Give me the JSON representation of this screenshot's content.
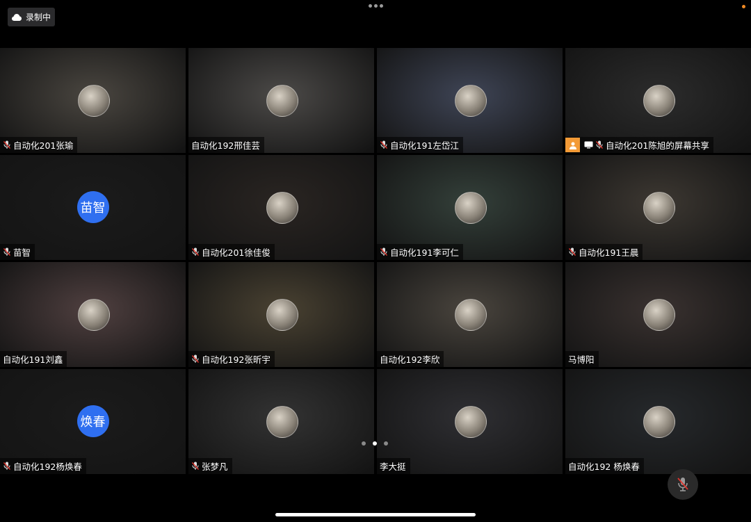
{
  "recording": {
    "label": "录制中",
    "icon": "cloud-icon"
  },
  "colors": {
    "avatar_text_bg": "#2f6ff0",
    "share_chip": "#f39a36",
    "muted_mic": "#e0372f",
    "page_bg": "#000000"
  },
  "participants": [
    {
      "name": "自动化201张瑜",
      "muted": true,
      "avatar": "photo-cat",
      "bg": "#4a4640"
    },
    {
      "name": "自动化192邢佳芸",
      "muted": false,
      "avatar": "photo-cat-grey",
      "bg": "#4c4a48"
    },
    {
      "name": "自动化191左岱江",
      "muted": true,
      "avatar": "photo-anime",
      "bg": "#3f4556"
    },
    {
      "name": "自动化201陈旭的屏幕共享",
      "muted": true,
      "screen_share": true,
      "avatar": "photo-scene",
      "bg": "#2c2c2c"
    },
    {
      "name": "苗智",
      "muted": true,
      "avatar_text": "苗智",
      "bg": "#1b1b1b"
    },
    {
      "name": "自动化201徐佳俊",
      "muted": true,
      "avatar": "photo-person",
      "bg": "#2a2522"
    },
    {
      "name": "自动化191李可仁",
      "muted": true,
      "avatar": "photo-anime-boy",
      "bg": "#34403a"
    },
    {
      "name": "自动化191王晨",
      "muted": true,
      "avatar": "photo-person-light",
      "bg": "#3d3832"
    },
    {
      "name": "自动化191刘鑫",
      "muted": false,
      "avatar": "photo-ink",
      "bg": "#504040"
    },
    {
      "name": "自动化192张昕宇",
      "muted": true,
      "avatar": "photo-painting",
      "bg": "#4a4232"
    },
    {
      "name": "自动化192李欣",
      "muted": false,
      "avatar": "photo-landscape",
      "bg": "#4a453e"
    },
    {
      "name": "马博阳",
      "muted": false,
      "avatar": "photo-astronaut",
      "bg": "#3a3230"
    },
    {
      "name": "自动化192杨焕春",
      "muted": true,
      "avatar_text": "焕春",
      "bg": "#1b1b1b"
    },
    {
      "name": "张梦凡",
      "muted": true,
      "avatar": "photo-bw",
      "bg": "#333333"
    },
    {
      "name": "李大挺",
      "muted": false,
      "avatar": "photo-food",
      "bg": "#2f2f33"
    },
    {
      "name": "自动化192 杨焕春",
      "muted": false,
      "avatar": "photo-anime-girl",
      "bg": "#26292c"
    }
  ],
  "pager": {
    "count": 3,
    "active": 1
  },
  "mic_button": {
    "icon": "mic-muted-icon"
  }
}
